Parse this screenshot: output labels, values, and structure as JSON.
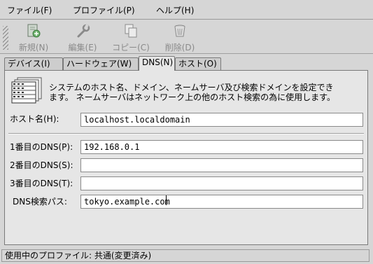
{
  "menubar": {
    "items": [
      "ファイル(F)",
      "プロファイル(P)",
      "ヘルプ(H)"
    ]
  },
  "toolbar": {
    "items": [
      {
        "label": "新規(N)",
        "icon": "new-icon"
      },
      {
        "label": "編集(E)",
        "icon": "edit-icon"
      },
      {
        "label": "コピー(C)",
        "icon": "copy-icon"
      },
      {
        "label": "削除(D)",
        "icon": "delete-icon"
      }
    ]
  },
  "tabs": [
    "デバイス(I)",
    "ハードウェア(W)",
    "DNS(N)",
    "ホスト(O)"
  ],
  "active_tab": "DNS(N)",
  "dns": {
    "description_line1": "システムのホスト名、ドメイン、ネームサーバ及び検索ドメインを設定でき",
    "description_line2": "ます。 ネームサーバはネットワーク上の他のホスト検索の為に使用します。",
    "hostname_label": "ホスト名(H):",
    "hostname_value": "localhost.localdomain",
    "dns1_label": "1番目のDNS(P):",
    "dns1_value": "192.168.0.1",
    "dns2_label": "2番目のDNS(S):",
    "dns2_value": "",
    "dns3_label": "3番目のDNS(T):",
    "dns3_value": "",
    "search_label": "DNS検索パス:",
    "search_value": "tokyo.example.com"
  },
  "statusbar": {
    "text": "使用中のプロファイル: 共通(変更済み)"
  }
}
